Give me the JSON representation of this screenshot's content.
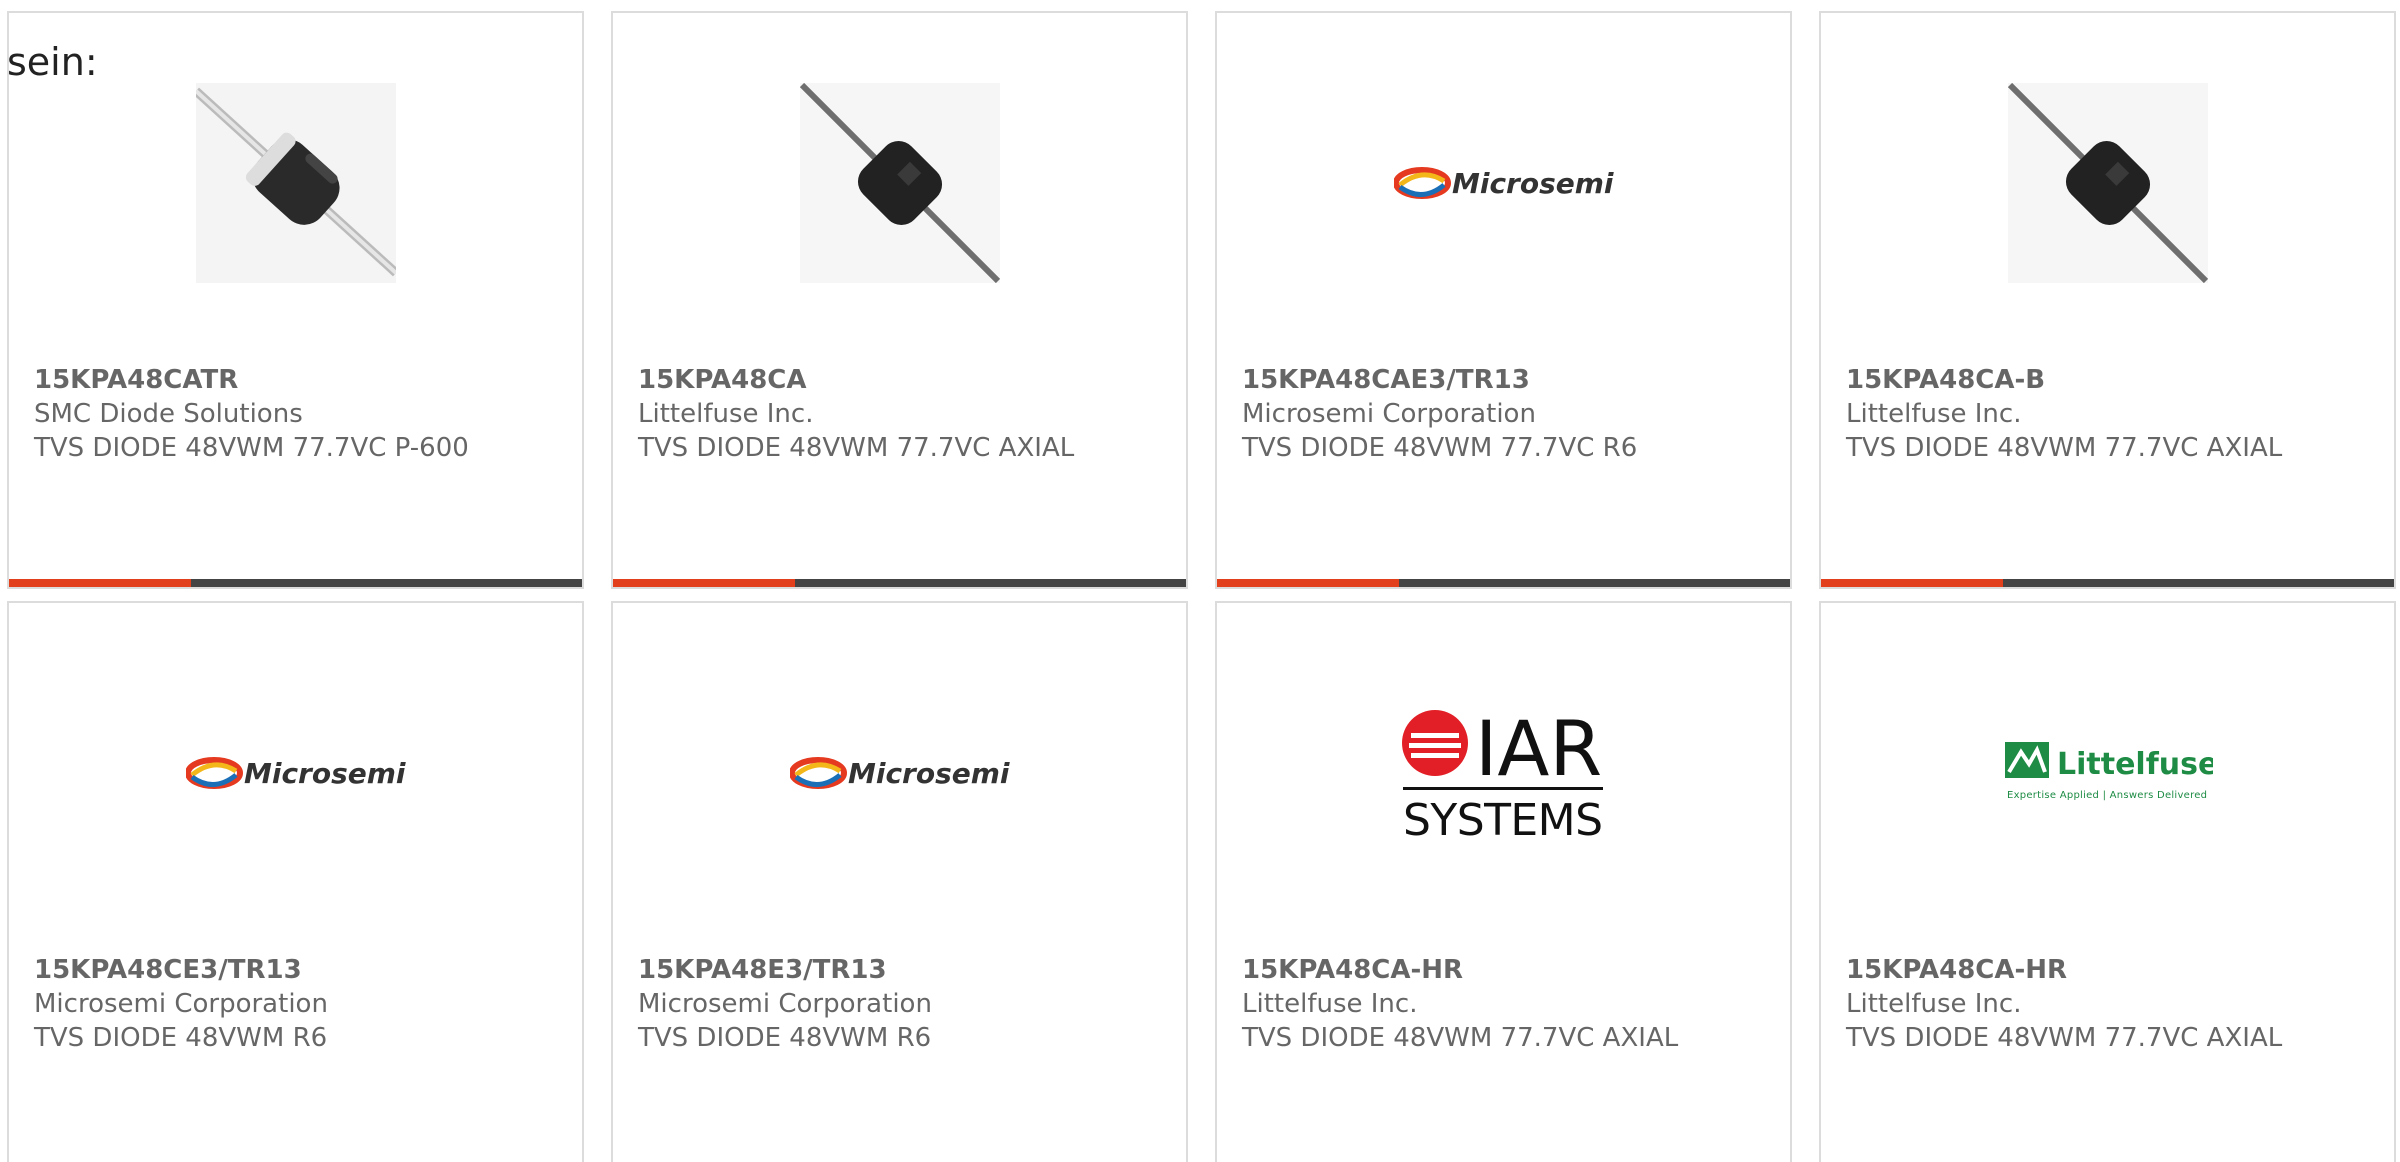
{
  "lead_text": "sein:",
  "colors": {
    "card_border": "#dcdcdc",
    "text": "#666666",
    "bar_dark": "#444444",
    "bar_accent": "#e2401c"
  },
  "cards": [
    {
      "part": "15KPA48CATR",
      "maker": "SMC Diode Solutions",
      "desc": "TVS DIODE 48VWM 77.7VC P-600",
      "image": "diode-banded-icon",
      "accent_bar": true
    },
    {
      "part": "15KPA48CA",
      "maker": "Littelfuse Inc.",
      "desc": "TVS DIODE 48VWM 77.7VC AXIAL",
      "image": "diode-axial-icon",
      "accent_bar": true
    },
    {
      "part": "15KPA48CAE3/TR13",
      "maker": "Microsemi Corporation",
      "desc": "TVS DIODE 48VWM 77.7VC R6",
      "image": "microsemi-logo",
      "accent_bar": true
    },
    {
      "part": "15KPA48CA-B",
      "maker": "Littelfuse Inc.",
      "desc": "TVS DIODE 48VWM 77.7VC AXIAL",
      "image": "diode-axial-icon",
      "accent_bar": true
    },
    {
      "part": "15KPA48CE3/TR13",
      "maker": "Microsemi Corporation",
      "desc": "TVS DIODE 48VWM R6",
      "image": "microsemi-logo",
      "accent_bar": false
    },
    {
      "part": "15KPA48E3/TR13",
      "maker": "Microsemi Corporation",
      "desc": "TVS DIODE 48VWM R6",
      "image": "microsemi-logo",
      "accent_bar": false
    },
    {
      "part": "15KPA48CA-HR",
      "maker": "Littelfuse Inc.",
      "desc": "TVS DIODE 48VWM 77.7VC AXIAL",
      "image": "iar-systems-logo",
      "accent_bar": false
    },
    {
      "part": "15KPA48CA-HR",
      "maker": "Littelfuse Inc.",
      "desc": "TVS DIODE 48VWM 77.7VC AXIAL",
      "image": "littelfuse-logo",
      "accent_bar": false
    }
  ],
  "logos": {
    "microsemi": "Microsemi",
    "iar_top": "IAR",
    "iar_bottom": "SYSTEMS",
    "littelfuse": "Littelfuse",
    "littelfuse_tagline": "Expertise Applied | Answers Delivered"
  }
}
